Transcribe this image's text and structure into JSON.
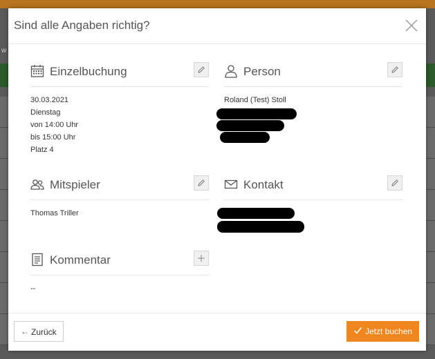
{
  "dialog": {
    "title": "Sind alle Angaben richtig?"
  },
  "sections": {
    "booking": {
      "title": "Einzelbuchung",
      "lines": [
        "30.03.2021",
        "Dienstag",
        "von 14:00 Uhr",
        "bis 15:00 Uhr",
        "Platz 4"
      ]
    },
    "person": {
      "title": "Person",
      "name": "Roland (Test) Stoll"
    },
    "players": {
      "title": "Mitspieler",
      "name": "Thomas Triller"
    },
    "contact": {
      "title": "Kontakt"
    },
    "comment": {
      "title": "Kommentar",
      "value": "--"
    }
  },
  "footer": {
    "back_label": "Zurück",
    "book_label": "Jetzt buchen"
  },
  "colors": {
    "accent": "#f0861f",
    "text": "#333333",
    "muted": "#555555"
  },
  "icons": {
    "booking": "calendar-icon",
    "person": "person-icon",
    "players": "users-icon",
    "contact": "mail-icon",
    "comment": "document-icon",
    "edit": "pencil-icon",
    "add": "plus-icon",
    "close": "close-icon",
    "back": "arrow-left-icon",
    "book": "check-icon"
  }
}
